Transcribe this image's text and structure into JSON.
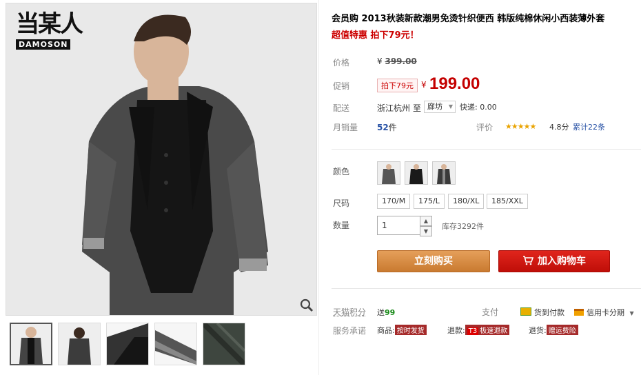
{
  "brand": {
    "cn": "当某人",
    "en": "DAMOSON"
  },
  "title": "会员购 2013秋装新款潮男免烫针织便西 韩版纯棉休闲小西装薄外套",
  "promo": "超值特惠 拍下79元！",
  "price_row": {
    "label": "价格",
    "currency": "¥",
    "original": "399.00"
  },
  "promo_row": {
    "label": "促销",
    "tag": "拍下79元",
    "currency": "¥",
    "price": "199.00"
  },
  "shipping_row": {
    "label": "配送",
    "from": "浙江杭州",
    "to_word": "至",
    "dest": "廊坊",
    "express": "快递: 0.00"
  },
  "sales_row": {
    "label": "月销量",
    "count": "52",
    "unit": "件",
    "rating_label": "评价",
    "stars": "★★★★★",
    "score": "4.8分",
    "total": "累计22条"
  },
  "color_row": {
    "label": "颜色"
  },
  "size_row": {
    "label": "尺码",
    "sizes": [
      "170/M",
      "175/L",
      "180/XL",
      "185/XXL"
    ]
  },
  "qty_row": {
    "label": "数量",
    "value": "1",
    "stock": "库存3292件"
  },
  "buttons": {
    "buy": "立刻购买",
    "cart": "加入购物车"
  },
  "points_row": {
    "label": "天猫积分",
    "send": "送",
    "points": "99",
    "pay_label": "支付",
    "cod": "货到付款",
    "installment": "信用卡分期"
  },
  "service_row": {
    "label": "服务承诺",
    "goods": "商品:",
    "goods_tag": "按时发货",
    "refund": "退款:",
    "refund_tag": "极速退款",
    "return": "退货:",
    "return_tag": "赠运费险"
  },
  "colors": {
    "price_red": "#c40000",
    "buy_orange": "#d4873f",
    "cart_red": "#d0180f",
    "points_green": "#1a8a1a"
  }
}
